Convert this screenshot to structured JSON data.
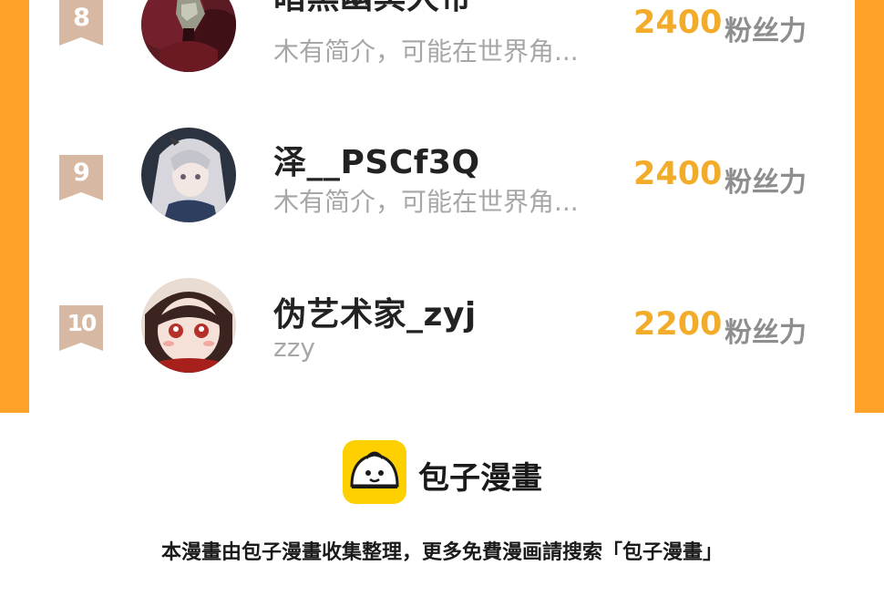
{
  "ranking": {
    "rows": [
      {
        "rank": "8",
        "name": "暗黑幽冥大帝",
        "bio": "木有简介，可能在世界角...",
        "score": "2400",
        "score_unit": "粉丝力",
        "avatar_icon": "dark-creature-avatar"
      },
      {
        "rank": "9",
        "name": "泽__PSCf3Q",
        "bio": "木有简介，可能在世界角...",
        "score": "2400",
        "score_unit": "粉丝力",
        "avatar_icon": "silver-hair-character-avatar"
      },
      {
        "rank": "10",
        "name": "伪艺术家_zyj",
        "bio": "zzy",
        "score": "2200",
        "score_unit": "粉丝力",
        "avatar_icon": "red-eyed-girl-avatar"
      }
    ]
  },
  "brand": {
    "name": "包子漫畫",
    "logo_icon": "bun-mascot-icon"
  },
  "footer": {
    "note": "本漫畫由包子漫畫收集整理，更多免費漫画請搜索「包子漫畫」"
  },
  "colors": {
    "frame": "#ffa22a",
    "score": "#f2ac2a",
    "rank_badge": "#d7b9a3",
    "logo_bg": "#ffd000"
  }
}
